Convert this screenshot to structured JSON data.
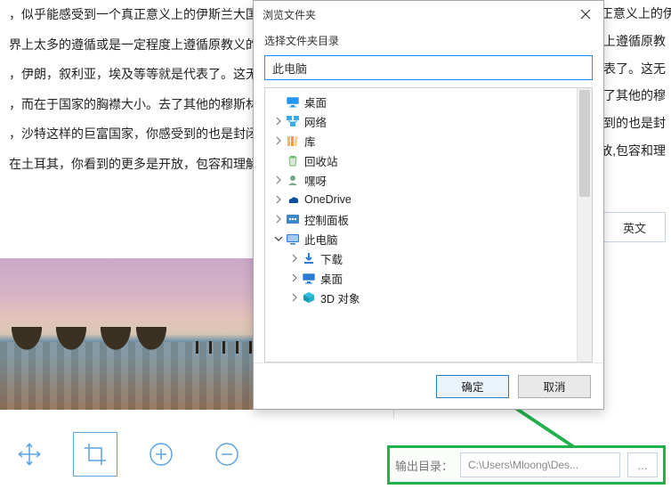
{
  "bg_left": {
    "lines": [
      "，似乎能感受到一个真正意义上的伊斯兰大国应有的开",
      "界上太多的遵循或是一定程度上遵循原教义的伊斯兰国",
      "，伊朗，叙利亚，埃及等等就是代表了。这无关乎人口",
      "，而在于国家的胸襟大小。去了其他的穆斯林国家像沙",
      "，沙特这样的巨富国家，你感受到的也是封闭。",
      "在土耳其，你看到的更多是开放，包容和理解。"
    ]
  },
  "bg_right": {
    "lines": [
      "来到土耳其,似乎能感受到一个真正意义上的伊斯",
      "定程度上遵循原教",
      "就是代表了。这无",
      "小。去了其他的穆",
      ",你感受到的也是封",
      "多是开放,包容和理"
    ]
  },
  "lang_label": "英文",
  "output": {
    "label": "输出目录：",
    "path": "C:\\Users\\Mloong\\Des...",
    "more": "..."
  },
  "dialog": {
    "title": "浏览文件夹",
    "subtitle": "选择文件夹目录",
    "input_value": "此电脑",
    "ok": "确定",
    "cancel": "取消"
  },
  "tree": [
    {
      "depth": 0,
      "twisty": "none",
      "icon": "desktop",
      "label": "桌面"
    },
    {
      "depth": 0,
      "twisty": "right",
      "icon": "network",
      "label": "网络"
    },
    {
      "depth": 0,
      "twisty": "right",
      "icon": "library",
      "label": "库"
    },
    {
      "depth": 0,
      "twisty": "none",
      "icon": "recycle",
      "label": "回收站"
    },
    {
      "depth": 0,
      "twisty": "right",
      "icon": "user",
      "label": "嘿呀"
    },
    {
      "depth": 0,
      "twisty": "right",
      "icon": "onedrive",
      "label": "OneDrive"
    },
    {
      "depth": 0,
      "twisty": "right",
      "icon": "control",
      "label": "控制面板"
    },
    {
      "depth": 0,
      "twisty": "down",
      "icon": "pc",
      "label": "此电脑"
    },
    {
      "depth": 1,
      "twisty": "right",
      "icon": "download",
      "label": "下载"
    },
    {
      "depth": 1,
      "twisty": "right",
      "icon": "desktop2",
      "label": "桌面"
    },
    {
      "depth": 1,
      "twisty": "right",
      "icon": "3d",
      "label": "3D 对象"
    }
  ],
  "tools": {
    "move": "move-icon",
    "crop": "crop-icon",
    "zoomin": "zoom-in-icon",
    "zoomout": "zoom-out-icon"
  }
}
